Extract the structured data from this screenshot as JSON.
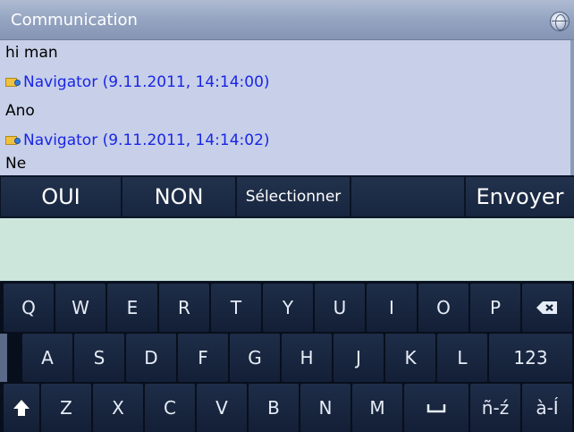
{
  "app": {
    "title": "Communication",
    "title_icon": "globe-icon"
  },
  "messages": [
    {
      "kind": "text",
      "text": "hi man"
    },
    {
      "kind": "header",
      "icon": "mail-icon",
      "text": "Navigator (9.11.2011, 14:14:00)"
    },
    {
      "kind": "text",
      "text": "Ano"
    },
    {
      "kind": "header",
      "icon": "mail-icon",
      "text": "Navigator (9.11.2011, 14:14:02)"
    },
    {
      "kind": "text",
      "text": "Ne"
    }
  ],
  "actions": {
    "oui": "OUI",
    "non": "NON",
    "select": "Sélectionner",
    "send": "Envoyer"
  },
  "input": {
    "value": "",
    "placeholder": ""
  },
  "keyboard": {
    "row1": [
      "Q",
      "W",
      "E",
      "R",
      "T",
      "Y",
      "U",
      "I",
      "O",
      "P"
    ],
    "backspace_icon": "backspace-icon",
    "row2": [
      "A",
      "S",
      "D",
      "F",
      "G",
      "H",
      "J",
      "K",
      "L"
    ],
    "numbers": "123",
    "shift_icon": "shift-icon",
    "row3": [
      "Z",
      "X",
      "C",
      "V",
      "B",
      "N",
      "M"
    ],
    "space_icon": "space-icon",
    "accents1": "ñ-ź",
    "accents2": "à-Í"
  },
  "colors": {
    "title_bar": "#94a4c1",
    "chat_bg": "#c7d0e8",
    "link_blue": "#1a25e6",
    "input_bg": "#cce6dc",
    "key_bg": "#1a2840"
  }
}
